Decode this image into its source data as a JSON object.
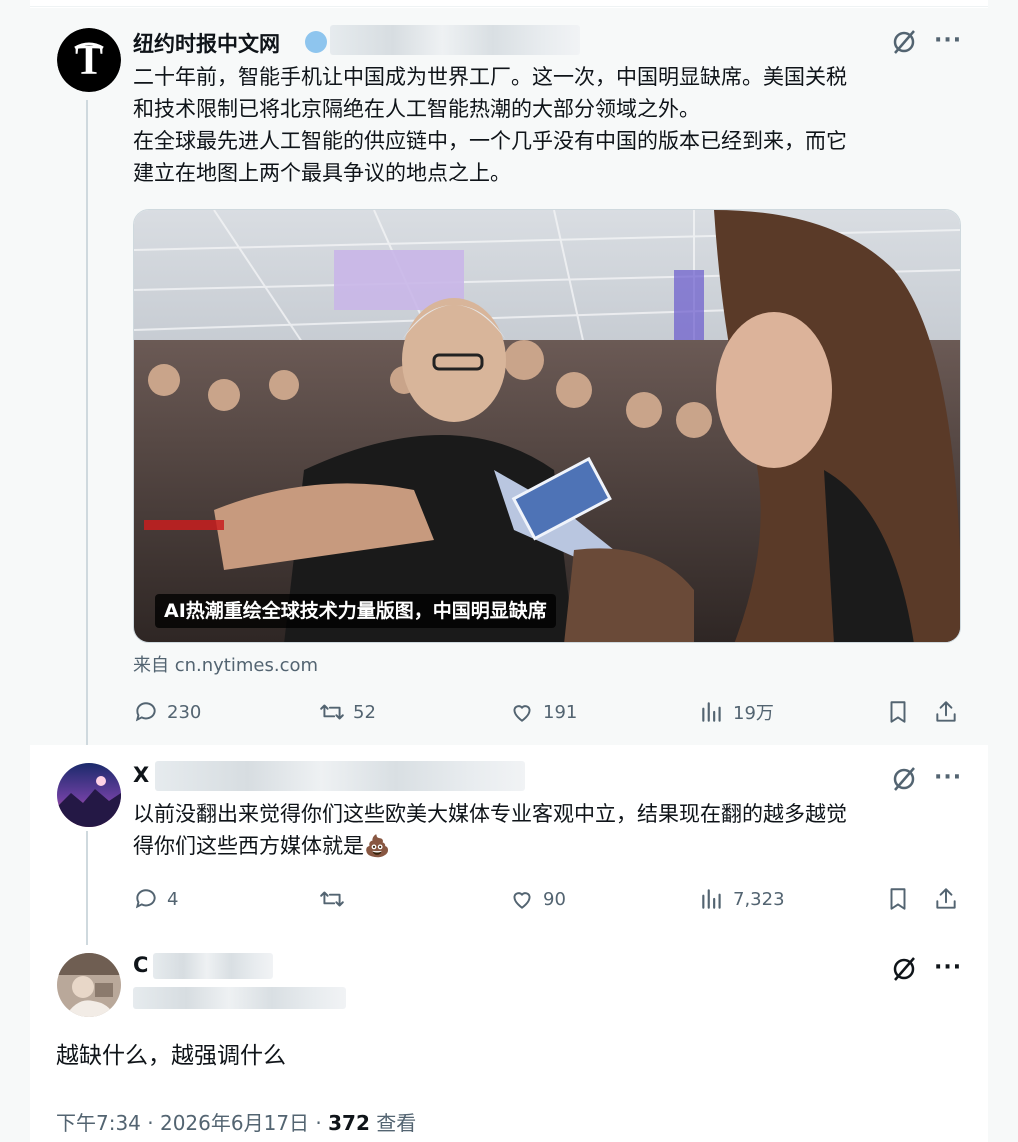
{
  "thread": {
    "main": {
      "author_name": "纽约时报中文网",
      "text_lines": [
        "二十年前，智能手机让中国成为世界工厂。这一次，中国明显缺席。美国关税",
        "和技术限制已将北京隔绝在人工智能热潮的大部分领域之外。",
        "在全球最先进人工智能的供应链中，一个几乎没有中国的版本已经到来，而它",
        "建立在地图上两个最具争议的地点之上。"
      ],
      "media_caption": "AI热潮重绘全球技术力量版图，中国明显缺席",
      "source": "来自 cn.nytimes.com",
      "stats": {
        "replies": "230",
        "reposts": "52",
        "likes": "191",
        "views": "19万"
      }
    },
    "reply": {
      "author_name_visible": "X",
      "text_lines": [
        "以前没翻出来觉得你们这些欧美大媒体专业客观中立，结果现在翻的越多越觉",
        "得你们这些西方媒体就是💩"
      ],
      "stats": {
        "replies": "4",
        "reposts": "",
        "likes": "90",
        "views": "7,323"
      }
    },
    "focus": {
      "author_name_visible": "C",
      "text": "越缺什么，越强调什么",
      "time": "下午7:34 · 2026年6月17日 · ",
      "view_count": "372",
      "view_label": " 查看"
    }
  },
  "icons": {
    "reply": "reply-icon",
    "repost": "repost-icon",
    "like": "heart-icon",
    "views": "views-icon",
    "bookmark": "bookmark-icon",
    "share": "share-icon",
    "grok": "grok-icon",
    "more": "more-icon"
  },
  "colors": {
    "text_primary": "#0f1419",
    "text_secondary": "#536471",
    "thread_line": "#cfd9de",
    "verified_badge": "#1d9bf0"
  }
}
